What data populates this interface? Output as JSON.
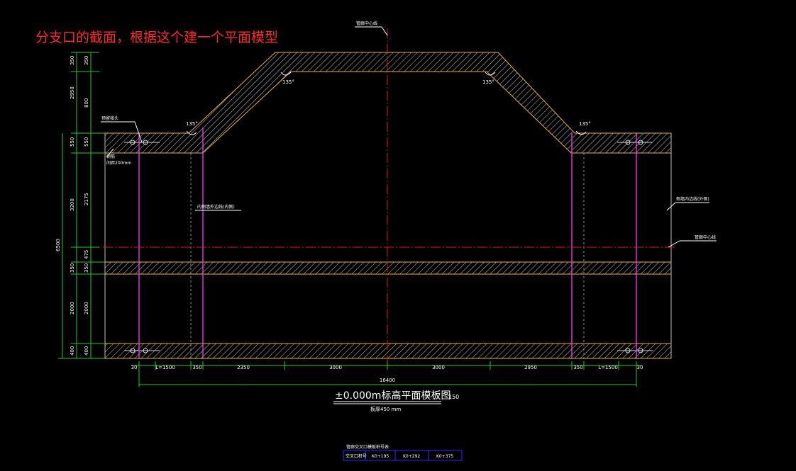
{
  "annotation": {
    "note": "分支口的截面，根据这个建一个平面模型"
  },
  "drawing": {
    "title_main": "±0.000m标高平面模板图",
    "title_scale": "150",
    "title_sub": "板厚450 mm",
    "centerline_label": "管廊中心线",
    "labels": {
      "top_left": "侧墙内边线(外侧)",
      "mid_left": "内侧墙外边线(内侧)",
      "mid_right": "侧墙内边线(外侧)",
      "right_axis": "管廊中心线",
      "rebar1": "预留接头",
      "rebar2": "钢筋",
      "rebar3": "间距200mm"
    },
    "angles": [
      "135°",
      "135°",
      "135°",
      "135°"
    ],
    "left_dims_outer": [
      "350",
      "2950",
      "550",
      "3200",
      "6500",
      "350",
      "2000",
      "400"
    ],
    "left_dims_inner": [
      "350",
      "800",
      "550",
      "2175",
      "475",
      "350",
      "2000",
      "400"
    ],
    "bottom_dims": [
      "30",
      "L=1500",
      "350",
      "2350",
      "3000",
      "3000",
      "2950",
      "350",
      "L=1500",
      "30"
    ],
    "total_dim": "16400",
    "table": {
      "title": "管廊交叉口模板桩号表",
      "cells": [
        "交叉口桩号",
        "K0+195",
        "K0+292",
        "K0+375"
      ]
    }
  }
}
